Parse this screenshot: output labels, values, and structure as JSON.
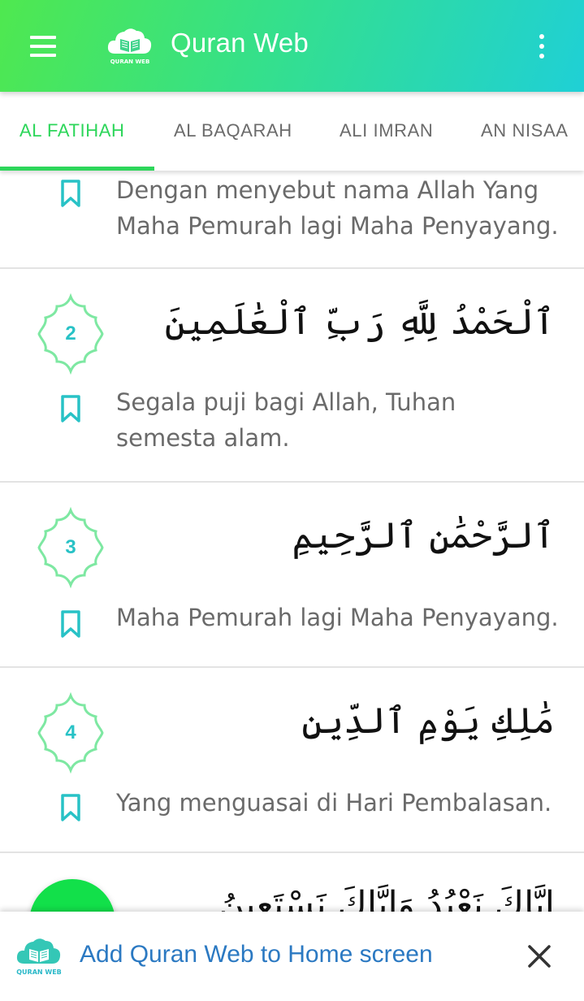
{
  "app": {
    "title": "Quran Web",
    "logo_text": "QURAN WEB"
  },
  "tabs": [
    {
      "label": "AL FATIHAH",
      "active": true
    },
    {
      "label": "AL BAQARAH",
      "active": false
    },
    {
      "label": "ALI IMRAN",
      "active": false
    },
    {
      "label": "AN NISAA",
      "active": false
    }
  ],
  "verses": [
    {
      "number": "",
      "arabic": "",
      "translation": "Dengan menyebut nama Allah Yang Maha Pemurah lagi Maha Penyayang."
    },
    {
      "number": "2",
      "arabic": "ٱلْحَمْدُ لِلَّهِ رَبِّ ٱلْعَٰلَمِينَ",
      "translation": "Segala puji bagi Allah, Tuhan semesta alam."
    },
    {
      "number": "3",
      "arabic": "ٱلرَّحْمَٰنِ ٱلرَّحِيمِ",
      "translation": "Maha Pemurah lagi Maha Penyayang."
    },
    {
      "number": "4",
      "arabic": "مَٰلِكِ يَوْمِ ٱلدِّينِ",
      "translation": "Yang menguasai di Hari Pembalasan."
    },
    {
      "number": "",
      "arabic": "إِيَّاكَ نَعْبُدُ وَإِيَّاكَ نَسْتَعِينُ",
      "translation": ""
    }
  ],
  "add_to_home": {
    "text": "Add Quran Web to Home screen",
    "logo_text": "QURAN WEB"
  },
  "colors": {
    "accent": "#2dd65a",
    "verse_number": "#28c2c6",
    "link": "#2b79c2"
  }
}
